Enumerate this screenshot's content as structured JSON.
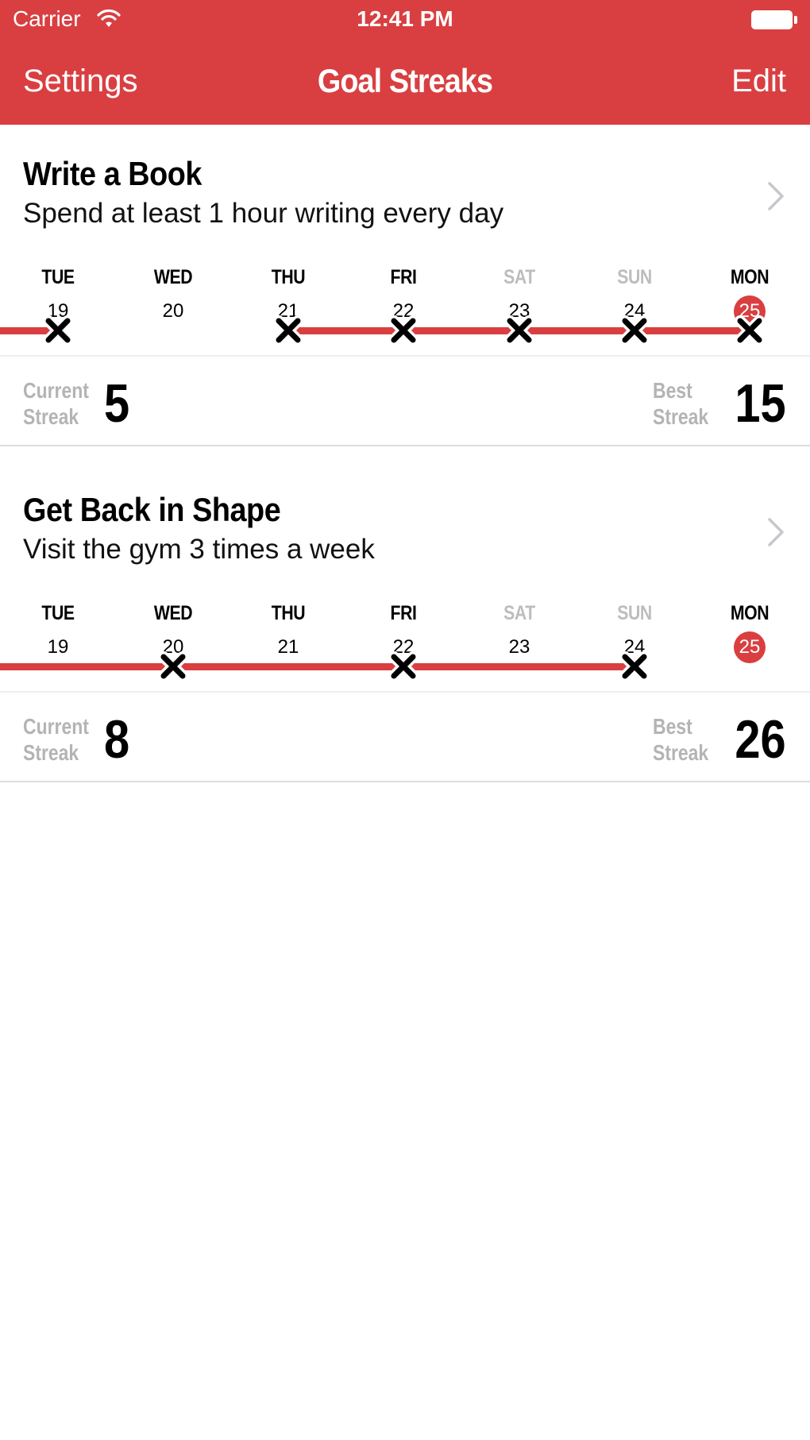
{
  "status_bar": {
    "carrier": "Carrier",
    "time": "12:41 PM",
    "wifi_icon": "wifi-icon",
    "battery_icon": "battery-full-icon"
  },
  "nav": {
    "left_button": "Settings",
    "title": "Goal Streaks",
    "right_button": "Edit"
  },
  "colors": {
    "accent": "#d93f41",
    "weekend_label": "#bdbdbd",
    "streak_label": "#b4b4b4"
  },
  "streak_labels": {
    "current": [
      "Current",
      "Streak"
    ],
    "best": [
      "Best",
      "Streak"
    ]
  },
  "goals": [
    {
      "title": "Write a Book",
      "description": "Spend at least 1 hour writing every day",
      "days": [
        {
          "name": "TUE",
          "num": "19",
          "weekend": false,
          "today": false,
          "done": true
        },
        {
          "name": "WED",
          "num": "20",
          "weekend": false,
          "today": false,
          "done": false
        },
        {
          "name": "THU",
          "num": "21",
          "weekend": false,
          "today": false,
          "done": true
        },
        {
          "name": "FRI",
          "num": "22",
          "weekend": false,
          "today": false,
          "done": true
        },
        {
          "name": "SAT",
          "num": "23",
          "weekend": true,
          "today": false,
          "done": true
        },
        {
          "name": "SUN",
          "num": "24",
          "weekend": true,
          "today": false,
          "done": true
        },
        {
          "name": "MON",
          "num": "25",
          "weekend": false,
          "today": true,
          "done": true
        }
      ],
      "streak_segments": [
        [
          -1,
          0
        ],
        [
          2,
          6
        ]
      ],
      "current_streak": "5",
      "best_streak": "15"
    },
    {
      "title": "Get Back in Shape",
      "description": "Visit the gym 3 times a week",
      "days": [
        {
          "name": "TUE",
          "num": "19",
          "weekend": false,
          "today": false,
          "done": false
        },
        {
          "name": "WED",
          "num": "20",
          "weekend": false,
          "today": false,
          "done": true
        },
        {
          "name": "THU",
          "num": "21",
          "weekend": false,
          "today": false,
          "done": false
        },
        {
          "name": "FRI",
          "num": "22",
          "weekend": false,
          "today": false,
          "done": true
        },
        {
          "name": "SAT",
          "num": "23",
          "weekend": true,
          "today": false,
          "done": false
        },
        {
          "name": "SUN",
          "num": "24",
          "weekend": true,
          "today": false,
          "done": true
        },
        {
          "name": "MON",
          "num": "25",
          "weekend": false,
          "today": true,
          "done": false
        }
      ],
      "streak_segments": [
        [
          -1,
          5
        ]
      ],
      "current_streak": "8",
      "best_streak": "26"
    }
  ]
}
